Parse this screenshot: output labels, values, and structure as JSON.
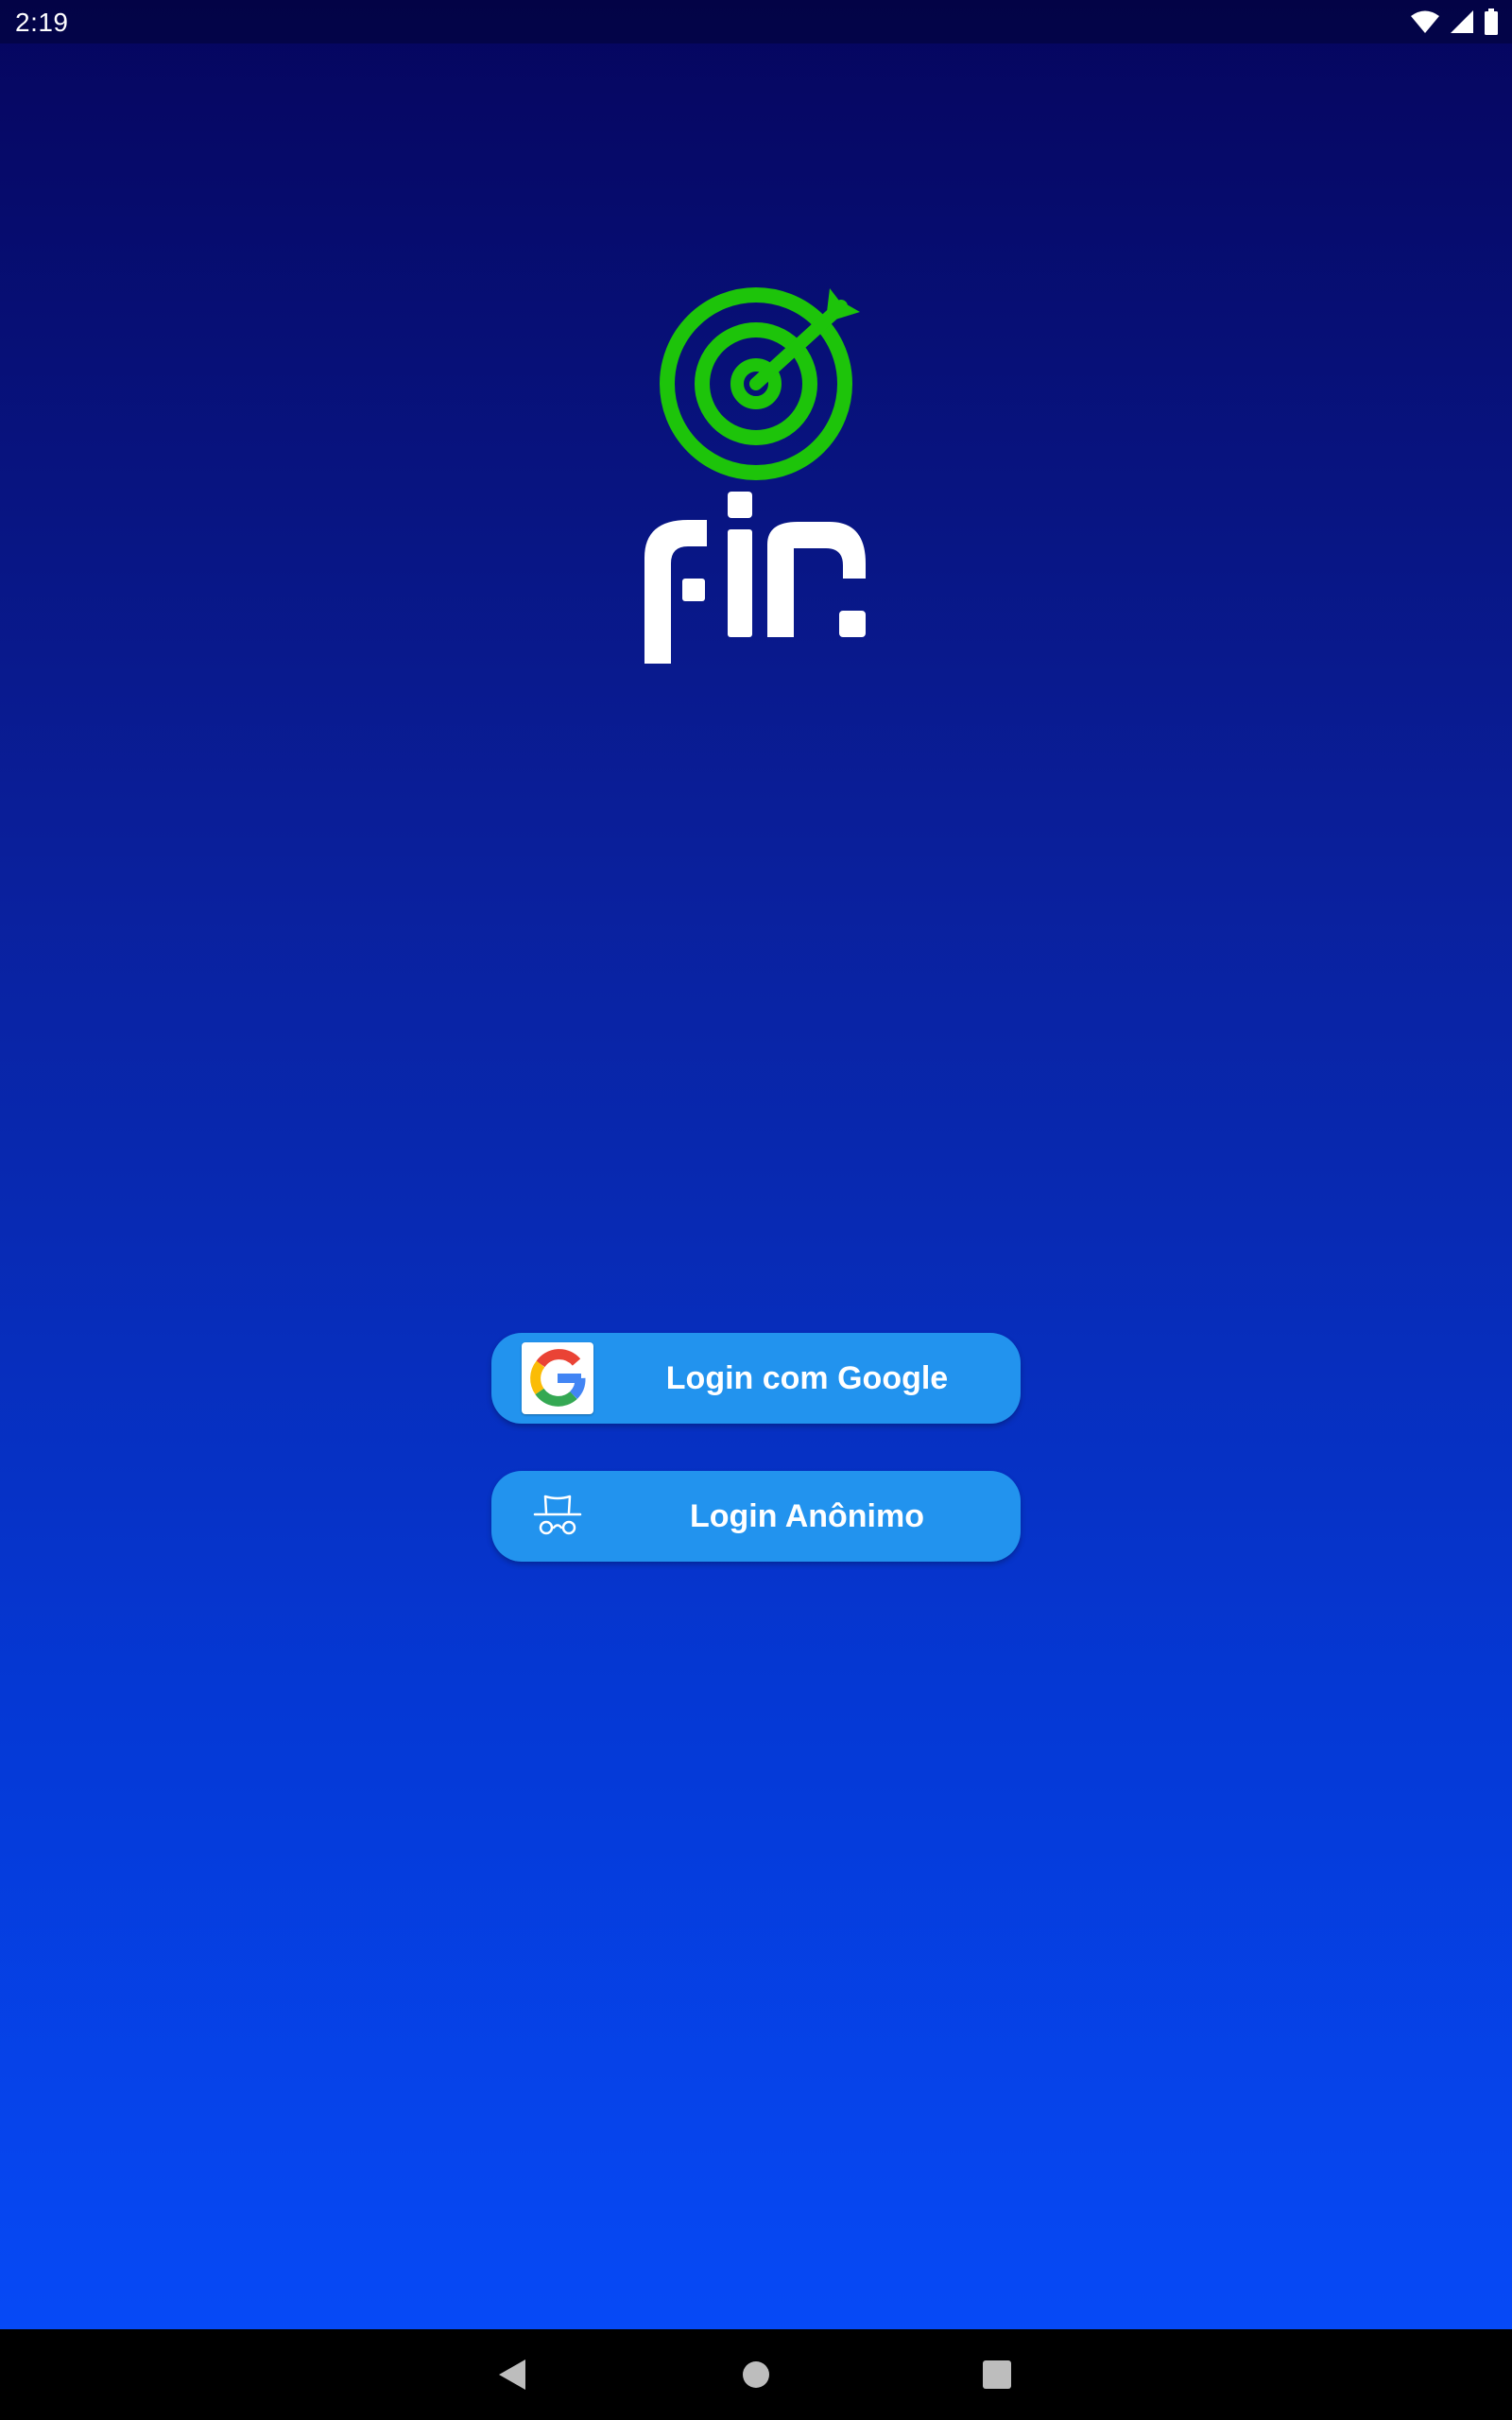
{
  "status_bar": {
    "time": "2:19",
    "icons": [
      "wifi-icon",
      "cell-signal-icon",
      "battery-icon"
    ]
  },
  "app": {
    "logo_text": "fin",
    "logo_icon": "target-arrow-icon",
    "colors": {
      "background_top": "#05055e",
      "background_bottom": "#064cfb",
      "logo_green": "#1dc40a",
      "button": "#2293ee"
    }
  },
  "buttons": {
    "google": {
      "label": "Login com Google",
      "icon": "google-g-icon"
    },
    "anonymous": {
      "label": "Login Anônimo",
      "icon": "incognito-icon"
    }
  },
  "nav_bar": {
    "icons": [
      "back-icon",
      "home-icon",
      "recents-icon"
    ]
  }
}
